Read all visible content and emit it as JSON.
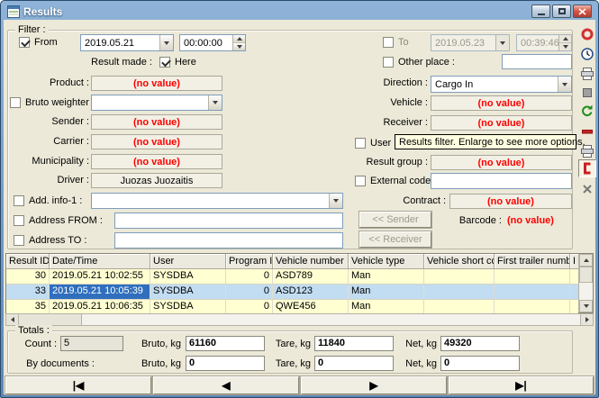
{
  "window": {
    "title": "Results"
  },
  "toolbar": {
    "items": [
      {
        "name": "ring-icon"
      },
      {
        "name": "clock-icon"
      },
      {
        "name": "printer-icon"
      },
      {
        "name": "stop-icon"
      },
      {
        "name": "refresh-icon"
      },
      {
        "name": "remove-icon"
      },
      {
        "name": "print-preview-icon"
      },
      {
        "name": "edit-icon"
      },
      {
        "name": "delete-icon"
      }
    ]
  },
  "filter": {
    "group_label": "Filter :",
    "from_label": "From",
    "from_date": "2019.05.21",
    "from_time": "00:00:00",
    "to_label": "To",
    "to_date": "2019.05.23",
    "to_time": "00:39:46",
    "result_made_label": "Result made :",
    "here_label": "Here",
    "other_place_label": "Other place :",
    "other_place_value": "",
    "product_label": "Product :",
    "product_value": "(no value)",
    "direction_label": "Direction :",
    "direction_value": "Cargo In",
    "bruto_weighter_label": "Bruto weighter :",
    "bruto_weighter_value": "",
    "vehicle_label": "Vehicle :",
    "vehicle_value": "(no value)",
    "sender_label": "Sender :",
    "sender_value": "(no value)",
    "receiver_label": "Receiver :",
    "receiver_value": "(no value)",
    "carrier_label": "Carrier :",
    "carrier_value": "(no value)",
    "user_label": "User :",
    "municipality_label": "Municipality :",
    "municipality_value": "(no value)",
    "result_group_label": "Result group :",
    "result_group_value": "(no value)",
    "driver_label": "Driver :",
    "driver_value": "Juozas Juozaitis",
    "external_code_label": "External code :",
    "external_code_value": "",
    "add_info1_label": "Add. info-1 :",
    "add_info1_value": "",
    "contract_label": "Contract :",
    "contract_value": "(no value)",
    "address_from_label": "Address FROM :",
    "address_from_value": "",
    "sender_button_label": "<< Sender",
    "barcode_label": "Barcode :",
    "barcode_value": "(no value)",
    "address_to_label": "Address TO :",
    "address_to_value": "",
    "receiver_button_label": "<< Receiver"
  },
  "tooltip": {
    "text": "Results filter.  Enlarge to see more options."
  },
  "grid": {
    "columns": [
      "Result ID",
      "Date/Time",
      "User",
      "Program ID",
      "Vehicle number",
      "Vehicle type",
      "Vehicle short code",
      "First trailer number",
      "I"
    ],
    "rows": [
      [
        "30",
        "2019.05.21 10:02:55",
        "SYSDBA",
        "0",
        "ASD789",
        "Man",
        "",
        "",
        ""
      ],
      [
        "33",
        "2019.05.21 10:05:39",
        "SYSDBA",
        "0",
        "ASD123",
        "Man",
        "",
        "",
        ""
      ],
      [
        "35",
        "2019.05.21 10:06:35",
        "SYSDBA",
        "0",
        "QWE456",
        "Man",
        "",
        "",
        ""
      ]
    ],
    "selected_row": 1
  },
  "totals": {
    "group_label": "Totals :",
    "count_label": "Count :",
    "count_value": "5",
    "bruto_label": "Bruto, kg",
    "bruto_value": "61160",
    "tare_label": "Tare, kg",
    "tare_value": "11840",
    "net_label": "Net, kg",
    "net_value": "49320",
    "by_documents_label": "By documents :",
    "doc_bruto_value": "0",
    "doc_tare_value": "0",
    "doc_net_value": "0"
  },
  "nav": {
    "first": "|◀",
    "prev": "◀",
    "next": "▶",
    "last": "▶|"
  }
}
